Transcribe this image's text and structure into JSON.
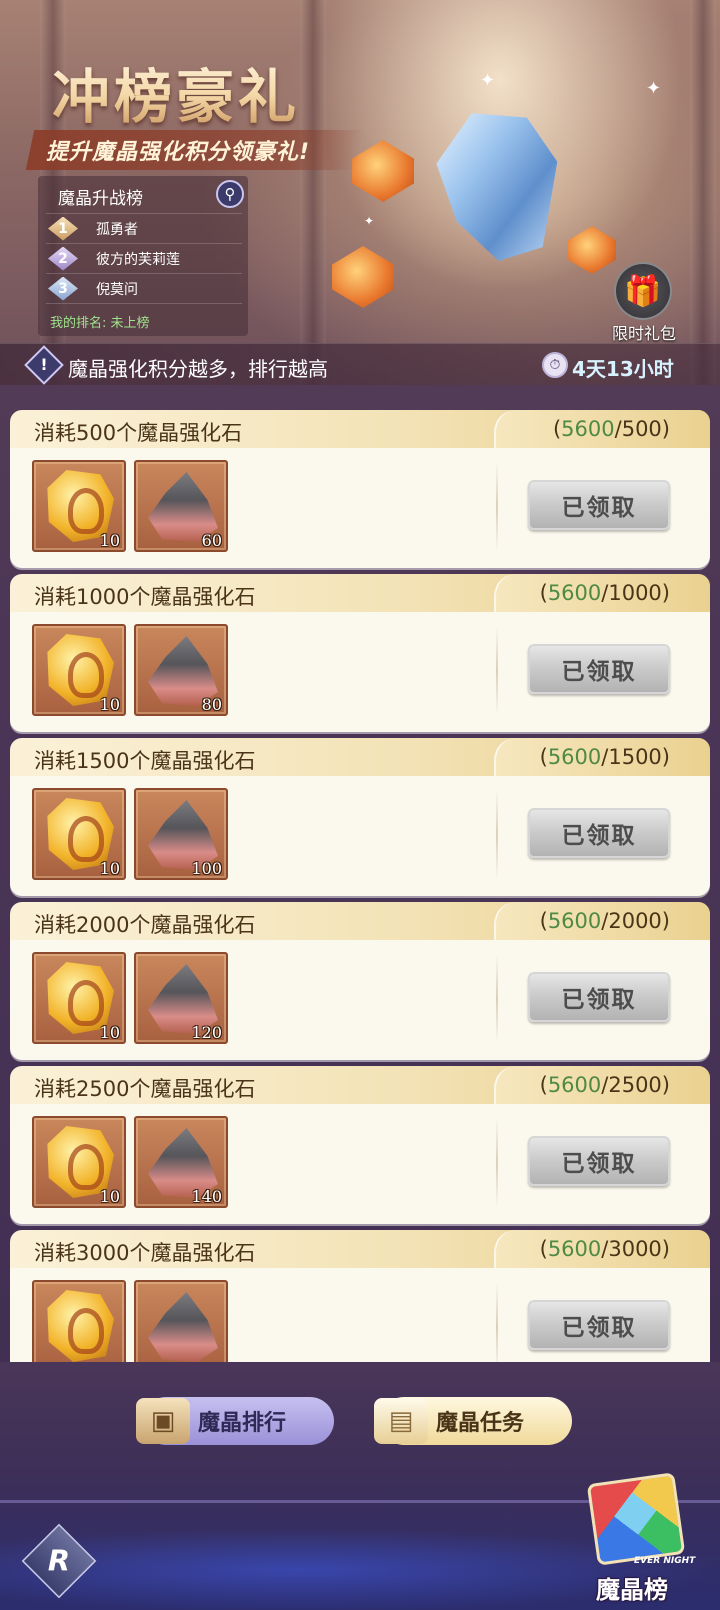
{
  "banner": {
    "title": "冲榜豪礼",
    "subtitle": "提升魔晶强化积分领豪礼!",
    "gift_label": "限时礼包"
  },
  "ranking": {
    "header": "魔晶升战榜",
    "rows": [
      {
        "rank": "1",
        "name": "孤勇者"
      },
      {
        "rank": "2",
        "name": "彼方的芙莉莲"
      },
      {
        "rank": "3",
        "name": "倪莫问"
      }
    ],
    "my_rank": "我的排名: 未上榜"
  },
  "info_bar": {
    "text": "魔晶强化积分越多，排行越高",
    "timer": "4天13小时"
  },
  "rewards": [
    {
      "title": "消耗500个魔晶强化石",
      "current": "5600",
      "target": "500",
      "item1_qty": "10",
      "item2_qty": "60",
      "button": "已领取"
    },
    {
      "title": "消耗1000个魔晶强化石",
      "current": "5600",
      "target": "1000",
      "item1_qty": "10",
      "item2_qty": "80",
      "button": "已领取"
    },
    {
      "title": "消耗1500个魔晶强化石",
      "current": "5600",
      "target": "1500",
      "item1_qty": "10",
      "item2_qty": "100",
      "button": "已领取"
    },
    {
      "title": "消耗2000个魔晶强化石",
      "current": "5600",
      "target": "2000",
      "item1_qty": "10",
      "item2_qty": "120",
      "button": "已领取"
    },
    {
      "title": "消耗2500个魔晶强化石",
      "current": "5600",
      "target": "2500",
      "item1_qty": "10",
      "item2_qty": "140",
      "button": "已领取"
    },
    {
      "title": "消耗3000个魔晶强化石",
      "current": "5600",
      "target": "3000",
      "item1_qty": "",
      "item2_qty": "",
      "button": "已领取"
    }
  ],
  "tabs": {
    "rank_label": "魔晶排行",
    "task_label": "魔晶任务"
  },
  "footer": {
    "badge_label": "魔晶榜",
    "badge_tag": "EVER NIGHT"
  },
  "colors": {
    "progress_current": "#4f8a45",
    "accent_gold": "#f3e3b7"
  }
}
